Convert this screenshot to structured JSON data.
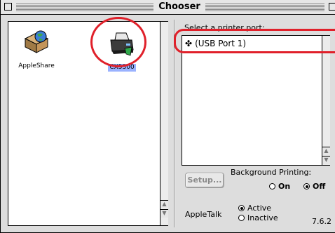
{
  "window": {
    "title": "Chooser"
  },
  "devices": [
    {
      "label": "AppleShare",
      "icon": "appleshare-icon",
      "selected": false
    },
    {
      "label": "CX5300",
      "icon": "printer-icon",
      "selected": true
    }
  ],
  "ports": {
    "heading": "Select a printer port:",
    "items": [
      {
        "symbol": "✤",
        "label": "(USB Port 1)"
      }
    ]
  },
  "setup": {
    "label": "Setup..."
  },
  "background_printing": {
    "label": "Background Printing:",
    "on_label": "On",
    "off_label": "Off",
    "selected": "Off"
  },
  "appletalk": {
    "label": "AppleTalk",
    "active_label": "Active",
    "inactive_label": "Inactive",
    "selected": "Active"
  },
  "version": "7.6.2",
  "colors": {
    "annotation": "#e0202a",
    "selection": "#9ab2ff"
  }
}
